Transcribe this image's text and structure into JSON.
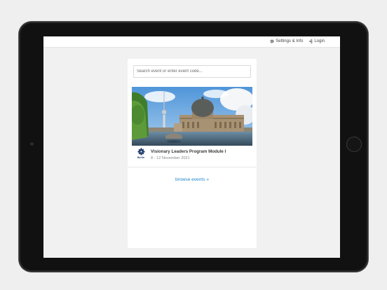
{
  "nav": {
    "settings_label": "Settings & Info",
    "login_label": "Login",
    "settings_icon": "gear-icon",
    "login_icon": "sign-in-icon"
  },
  "search": {
    "placeholder": "Search event or enter event code..."
  },
  "event": {
    "title": "Visionary Leaders Program Module I",
    "date": "8 - 12 November 2021",
    "logo_text": "Berlin",
    "logo_icon": "berlin-flower-logo"
  },
  "browse": {
    "label": "browse events »"
  },
  "colors": {
    "accent": "#1f86c9",
    "logo": "#1d3a6b"
  }
}
